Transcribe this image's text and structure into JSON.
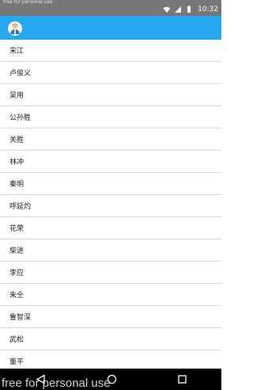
{
  "status_bar": {
    "notification_text": "free for personal use",
    "time": "10:32",
    "icons": [
      "wifi-icon",
      "signal-icon",
      "battery-icon"
    ]
  },
  "app_bar": {
    "icon": "app-avatar-icon",
    "color": "#25a8ee"
  },
  "list": {
    "items": [
      {
        "label": "宋江"
      },
      {
        "label": "卢俊义"
      },
      {
        "label": "吴用"
      },
      {
        "label": "公孙胜"
      },
      {
        "label": "关胜"
      },
      {
        "label": "林冲"
      },
      {
        "label": "秦明"
      },
      {
        "label": "呼延灼"
      },
      {
        "label": "花荣"
      },
      {
        "label": "柴进"
      },
      {
        "label": "李应"
      },
      {
        "label": "朱仝"
      },
      {
        "label": "鲁智深"
      },
      {
        "label": "武松"
      },
      {
        "label": "董平"
      }
    ]
  },
  "nav_bar": {
    "buttons": [
      "back-icon",
      "home-icon",
      "recent-apps-icon"
    ]
  },
  "watermark": {
    "text": "free for personal use"
  }
}
